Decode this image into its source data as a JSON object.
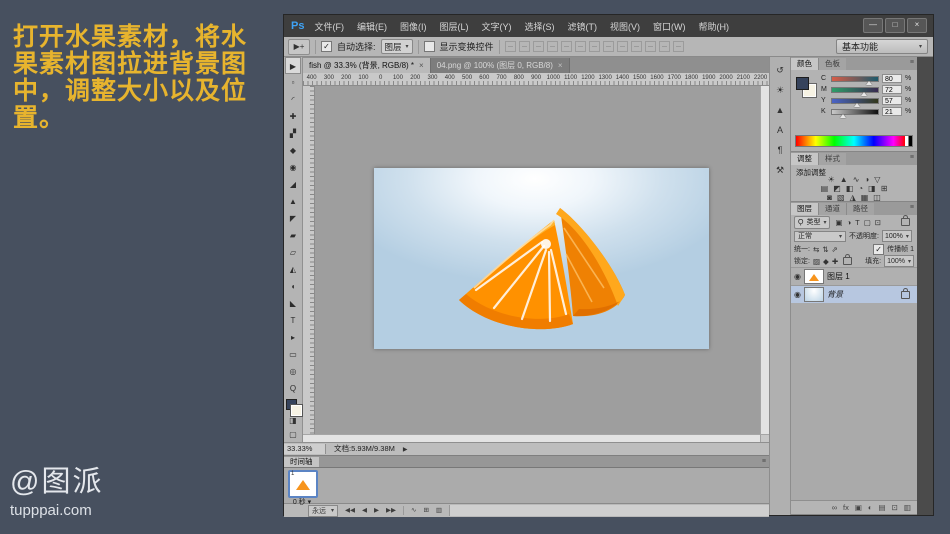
{
  "slide": {
    "caption_lines": [
      "打开水果素材，将水",
      "果素材图拉进背景图",
      "中，调整大小以及位",
      "置。"
    ],
    "caption_color": "#e7b42e",
    "background_color": "#47505f",
    "watermark": {
      "logo": "@图派",
      "url": "tupppai.com"
    }
  },
  "ps": {
    "logo": "Ps",
    "accent_blue": "#3fa3f5",
    "menus": [
      {
        "name": "menu-file",
        "label": "文件(F)"
      },
      {
        "name": "menu-edit",
        "label": "编辑(E)"
      },
      {
        "name": "menu-image",
        "label": "图像(I)"
      },
      {
        "name": "menu-layer",
        "label": "图层(L)"
      },
      {
        "name": "menu-type",
        "label": "文字(Y)"
      },
      {
        "name": "menu-select",
        "label": "选择(S)"
      },
      {
        "name": "menu-filter",
        "label": "滤镜(T)"
      },
      {
        "name": "menu-view",
        "label": "视图(V)"
      },
      {
        "name": "menu-window",
        "label": "窗口(W)"
      },
      {
        "name": "menu-help",
        "label": "帮助(H)"
      }
    ],
    "window_controls": [
      {
        "name": "minimize-button",
        "glyph": "—"
      },
      {
        "name": "maximize-button",
        "glyph": "□"
      },
      {
        "name": "close-button",
        "glyph": "×"
      }
    ],
    "options": {
      "tool_glyph": "▶+",
      "auto_select_label": "自动选择:",
      "auto_select_checked": "✓",
      "auto_select_value": "图层",
      "dropdown_arrow": "▾",
      "show_transform_label": "显示变换控件",
      "align_icons": [
        {
          "name": "align-top-edges-icon"
        },
        {
          "name": "align-vertical-centers-icon"
        },
        {
          "name": "align-bottom-edges-icon"
        },
        {
          "name": "align-left-edges-icon"
        },
        {
          "name": "align-horizontal-centers-icon"
        },
        {
          "name": "align-right-edges-icon"
        },
        {
          "name": "distribute-top-edges-icon"
        },
        {
          "name": "distribute-vertical-centers-icon"
        },
        {
          "name": "distribute-bottom-edges-icon"
        },
        {
          "name": "distribute-left-edges-icon"
        },
        {
          "name": "distribute-horizontal-centers-icon"
        },
        {
          "name": "distribute-right-edges-icon"
        },
        {
          "name": "auto-align-layers-icon"
        }
      ],
      "workspace": "基本功能"
    },
    "tabs": [
      {
        "label": "fish @ 33.3% (背景, RGB/8) *",
        "close": "×"
      },
      {
        "label": "04.png @ 100% (图层 0, RGB/8)",
        "close": "×"
      }
    ],
    "ruler_numbers": [
      "400",
      "300",
      "200",
      "100",
      "0",
      "100",
      "200",
      "300",
      "400",
      "500",
      "600",
      "700",
      "800",
      "900",
      "1000",
      "1100",
      "1200",
      "1300",
      "1400",
      "1500",
      "1600",
      "1700",
      "1800",
      "1900",
      "2000",
      "2100",
      "2200"
    ],
    "tools": [
      {
        "name": "move-tool",
        "glyph": "▶"
      },
      {
        "name": "rectangular-marquee-tool",
        "glyph": "▫"
      },
      {
        "name": "lasso-tool",
        "glyph": "◜"
      },
      {
        "name": "quick-selection-tool",
        "glyph": "✚"
      },
      {
        "name": "crop-tool",
        "glyph": "▞"
      },
      {
        "name": "eyedropper-tool",
        "glyph": "◆"
      },
      {
        "name": "spot-healing-brush-tool",
        "glyph": "◉"
      },
      {
        "name": "brush-tool",
        "glyph": "◢"
      },
      {
        "name": "clone-stamp-tool",
        "glyph": "▲"
      },
      {
        "name": "history-brush-tool",
        "glyph": "◤"
      },
      {
        "name": "eraser-tool",
        "glyph": "▰"
      },
      {
        "name": "gradient-tool",
        "glyph": "▱"
      },
      {
        "name": "blur-tool",
        "glyph": "◭"
      },
      {
        "name": "dodge-tool",
        "glyph": "◖"
      },
      {
        "name": "pen-tool",
        "glyph": "◣"
      },
      {
        "name": "type-tool",
        "glyph": "T"
      },
      {
        "name": "path-selection-tool",
        "glyph": "▸"
      },
      {
        "name": "rectangle-tool",
        "glyph": "▭"
      },
      {
        "name": "hand-tool",
        "glyph": "◎"
      },
      {
        "name": "zoom-tool",
        "glyph": "Q"
      }
    ],
    "tool_modes": [
      {
        "name": "quick-mask-mode-button",
        "glyph": "◨"
      },
      {
        "name": "screen-mode-button",
        "glyph": "▢"
      }
    ],
    "status": {
      "zoom": "33.33%",
      "doc": "文档:5.93M/9.38M",
      "arrow": "▶"
    },
    "dock_icons": [
      {
        "name": "history-panel-icon",
        "glyph": "↺"
      },
      {
        "name": "adjustments-panel-icon",
        "glyph": "☀"
      },
      {
        "name": "levels-panel-icon",
        "glyph": "▲"
      },
      {
        "name": "character-panel-icon",
        "glyph": "A"
      },
      {
        "name": "paragraph-panel-icon",
        "glyph": "¶"
      },
      {
        "name": "tool-presets-panel-icon",
        "glyph": "⚒"
      }
    ],
    "panels": {
      "color": {
        "tab_active": "颜色",
        "tab_inactive": "色板",
        "channels": [
          {
            "label": "C",
            "value": "80"
          },
          {
            "label": "M",
            "value": "72"
          },
          {
            "label": "Y",
            "value": "57"
          },
          {
            "label": "K",
            "value": "21"
          }
        ],
        "unit": "%"
      },
      "adjustments": {
        "tab_active": "调整",
        "tab_inactive": "样式",
        "add_label": "添加调整",
        "row1": [
          {
            "name": "brightness-contrast-icon",
            "glyph": "☀"
          },
          {
            "name": "levels-icon",
            "glyph": "▲"
          },
          {
            "name": "curves-icon",
            "glyph": "∿"
          },
          {
            "name": "exposure-icon",
            "glyph": "◑"
          },
          {
            "name": "vibrance-icon",
            "glyph": "▽"
          }
        ],
        "row2": [
          {
            "name": "hue-saturation-icon",
            "glyph": "▤"
          },
          {
            "name": "color-balance-icon",
            "glyph": "◩"
          },
          {
            "name": "black-white-icon",
            "glyph": "◧"
          },
          {
            "name": "photo-filter-icon",
            "glyph": "◔"
          },
          {
            "name": "channel-mixer-icon",
            "glyph": "◨"
          },
          {
            "name": "color-lookup-icon",
            "glyph": "⊞"
          }
        ],
        "row3": [
          {
            "name": "invert-icon",
            "glyph": "◙"
          },
          {
            "name": "posterize-icon",
            "glyph": "▧"
          },
          {
            "name": "threshold-icon",
            "glyph": "◮"
          },
          {
            "name": "gradient-map-icon",
            "glyph": "▦"
          },
          {
            "name": "selective-color-icon",
            "glyph": "◫"
          }
        ]
      },
      "layers": {
        "tab_active": "图层",
        "tab_channels": "通道",
        "tab_paths": "路径",
        "search_glyph": "Ϙ",
        "filter_value": "类型",
        "filter_icons": [
          {
            "name": "filter-pixel-layers-icon",
            "glyph": "▣"
          },
          {
            "name": "filter-adjustment-layers-icon",
            "glyph": "◑"
          },
          {
            "name": "filter-type-layers-icon",
            "glyph": "T"
          },
          {
            "name": "filter-shape-layers-icon",
            "glyph": "▢"
          },
          {
            "name": "filter-smart-objects-icon",
            "glyph": "⊡"
          }
        ],
        "blend_mode": "正常",
        "opacity_label": "不透明度:",
        "opacity_value": "100%",
        "unify_label": "统一:",
        "unify_icons": [
          {
            "name": "unify-position-icon",
            "glyph": "⇆"
          },
          {
            "name": "unify-visibility-icon",
            "glyph": "⇅"
          },
          {
            "name": "unify-style-icon",
            "glyph": "⇗"
          }
        ],
        "propagate_label": "传播帧 1",
        "propagate_checked": "✓",
        "lock_label": "锁定:",
        "lock_icons": [
          {
            "name": "lock-transparency-icon",
            "glyph": "▨"
          },
          {
            "name": "lock-pixels-icon",
            "glyph": "◆"
          },
          {
            "name": "lock-position-icon",
            "glyph": "✚"
          }
        ],
        "fill_label": "填充:",
        "fill_value": "100%",
        "layer1_name": "图层 1",
        "layer2_name": "背景",
        "bottom_icons": [
          {
            "name": "link-layers-icon",
            "glyph": "∞"
          },
          {
            "name": "layer-style-icon",
            "glyph": "fx"
          },
          {
            "name": "layer-mask-icon",
            "glyph": "▣"
          },
          {
            "name": "new-adjustment-layer-icon",
            "glyph": "◐"
          },
          {
            "name": "new-group-icon",
            "glyph": "▤"
          },
          {
            "name": "new-layer-icon",
            "glyph": "⊡"
          },
          {
            "name": "delete-layer-icon",
            "glyph": "▥"
          }
        ]
      }
    },
    "timeline": {
      "tab": "时间轴",
      "panel_menu_glyph": "≡",
      "frame_number": "1",
      "delay": "0 秒",
      "delay_arrow": "▾",
      "loop": "永远",
      "nav_buttons": [
        {
          "name": "first-frame-button",
          "glyph": "◀◀"
        },
        {
          "name": "previous-frame-button",
          "glyph": "◀"
        },
        {
          "name": "play-button",
          "glyph": "▶"
        },
        {
          "name": "next-frame-button",
          "glyph": "▶▶"
        }
      ],
      "edit_buttons": [
        {
          "name": "tween-button",
          "glyph": "∿"
        },
        {
          "name": "duplicate-frame-button",
          "glyph": "⊞"
        },
        {
          "name": "delete-frame-button",
          "glyph": "▥"
        }
      ]
    }
  }
}
